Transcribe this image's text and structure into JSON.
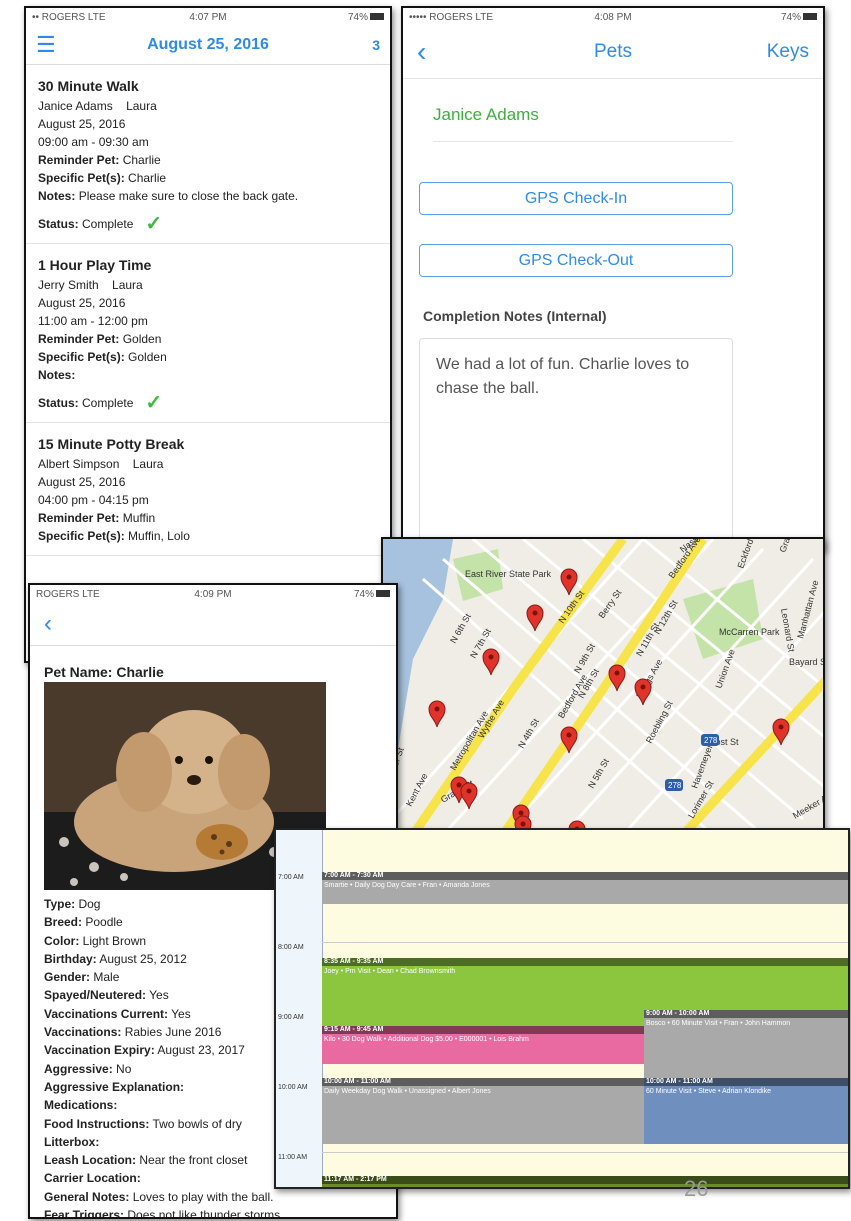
{
  "schedule_screen": {
    "status": {
      "carrier": "•• ROGERS LTE",
      "time": "4:07 PM",
      "battery": "74%"
    },
    "nav": {
      "title": "August 25, 2016",
      "count": "3"
    },
    "visits": [
      {
        "title": "30 Minute Walk",
        "client": "Janice Adams",
        "staff": "Laura",
        "date": "August 25, 2016",
        "time": "09:00 am  -  09:30 am",
        "reminder_pet": "Charlie",
        "specific_pets": "Charlie",
        "notes": "Please make sure to close the back gate.",
        "status": "Complete"
      },
      {
        "title": "1 Hour Play Time",
        "client": "Jerry Smith",
        "staff": "Laura",
        "date": "August 25, 2016",
        "time": "11:00 am  -  12:00 pm",
        "reminder_pet": "Golden",
        "specific_pets": "Golden",
        "notes": "",
        "status": "Complete"
      },
      {
        "title": "15 Minute Potty Break",
        "client": "Albert Simpson",
        "staff": "Laura",
        "date": "August 25, 2016",
        "time": "04:00 pm  -  04:15 pm",
        "reminder_pet": "Muffin",
        "specific_pets": "Muffin, Lolo"
      }
    ],
    "labels": {
      "reminder": "Reminder Pet:",
      "specific": "Specific Pet(s):",
      "notes": "Notes:",
      "status": "Status:"
    }
  },
  "visit_screen": {
    "status": {
      "carrier": "••••• ROGERS LTE",
      "time": "4:08 PM",
      "battery": "74%"
    },
    "nav": {
      "title": "Pets",
      "right": "Keys"
    },
    "client_name": "Janice Adams",
    "buttons": {
      "checkin": "GPS Check-In",
      "checkout": "GPS Check-Out"
    },
    "notes_label": "Completion Notes (Internal)",
    "notes_text": "We had a lot of fun.  Charlie loves to chase the ball."
  },
  "map": {
    "labels": [
      "East River State Park",
      "Kent Ave",
      "Berry St",
      "Bedford Ave",
      "Nassau Ave",
      "N 10th St",
      "N 12th St",
      "N 11th St",
      "N 9th St",
      "N 8th St",
      "N 7th St",
      "N 6th St",
      "N 4th St",
      "N 5th St",
      "Wythe Ave",
      "Metropolitan Ave",
      "Grand St",
      "River St",
      "Driggs Ave",
      "Roebling St",
      "Union Ave",
      "McCarren Park",
      "Frost St",
      "Leonard St",
      "Manhattan Ave",
      "Eckford St",
      "Graham Ave",
      "Bayard St",
      "Havemeyer St",
      "Bedford Ave",
      "Meeker Ave",
      "Lorimer St"
    ],
    "shields": [
      "278",
      "278"
    ]
  },
  "pet_screen": {
    "status": {
      "carrier": "ROGERS LTE",
      "time": "4:09 PM",
      "battery": "74%"
    },
    "pet_name_label": "Pet Name: Charlie",
    "details": [
      {
        "k": "Type:",
        "v": "Dog"
      },
      {
        "k": "Breed:",
        "v": "Poodle"
      },
      {
        "k": "Color:",
        "v": "Light Brown"
      },
      {
        "k": "Birthday:",
        "v": "August 25, 2012"
      },
      {
        "k": "Gender:",
        "v": "Male"
      },
      {
        "k": "Spayed/Neutered:",
        "v": "Yes"
      },
      {
        "k": "Vaccinations Current:",
        "v": "Yes"
      },
      {
        "k": "Vaccinations:",
        "v": "Rabies June 2016"
      },
      {
        "k": "Vaccination Expiry:",
        "v": "August 23, 2017"
      },
      {
        "k": "Aggressive:",
        "v": "No"
      },
      {
        "k": "Aggressive Explanation:",
        "v": ""
      },
      {
        "k": "Medications:",
        "v": ""
      },
      {
        "k": "Food Instructions:",
        "v": "Two bowls of dry"
      },
      {
        "k": "Litterbox:",
        "v": ""
      },
      {
        "k": "Leash Location:",
        "v": "Near the front closet"
      },
      {
        "k": "Carrier Location:",
        "v": ""
      },
      {
        "k": "General Notes:",
        "v": "Loves to play with the ball."
      },
      {
        "k": "Fear Triggers:",
        "v": "Does not like thunder storms."
      }
    ]
  },
  "calendar": {
    "times": [
      "7:00 AM",
      "8:00 AM",
      "9:00 AM",
      "10:00 AM",
      "11:00 AM"
    ],
    "appointments": [
      {
        "time": "7:00 AM - 7:30 AM",
        "text": "Smartie • Daily Dog Day Care • Fran • Amanda Jones",
        "color": "#a9a9a9"
      },
      {
        "time": "8:35 AM - 9:35 AM",
        "text": "Joey • Pm Visit • Dean • Chad Brownsmith",
        "color": "#8cc63f"
      },
      {
        "time": "9:00 AM - 10:00 AM",
        "text": "Bosco • 60 Minute Visit • Fran • John Hammon",
        "color": "#a9a9a9"
      },
      {
        "time": "9:15 AM - 9:45 AM",
        "text": "Kilo • 30 Dog Walk • Additional Dog $5.00 • E000001 • Lois Brahm",
        "color": "#e86aa0"
      },
      {
        "time": "10:00 AM - 11:00 AM",
        "text": "Daily Weekday Dog Walk • Unassigned • Albert Jones",
        "color": "#a9a9a9"
      },
      {
        "time": "10:00 AM - 11:00 AM",
        "text": "60 Minute Visit • Steve • Adrian Klondike",
        "color": "#6f8fbf"
      },
      {
        "time": "11:17 AM - 2:17 PM",
        "text": "",
        "color": "#6d8a2f"
      }
    ]
  },
  "page_number": "26"
}
